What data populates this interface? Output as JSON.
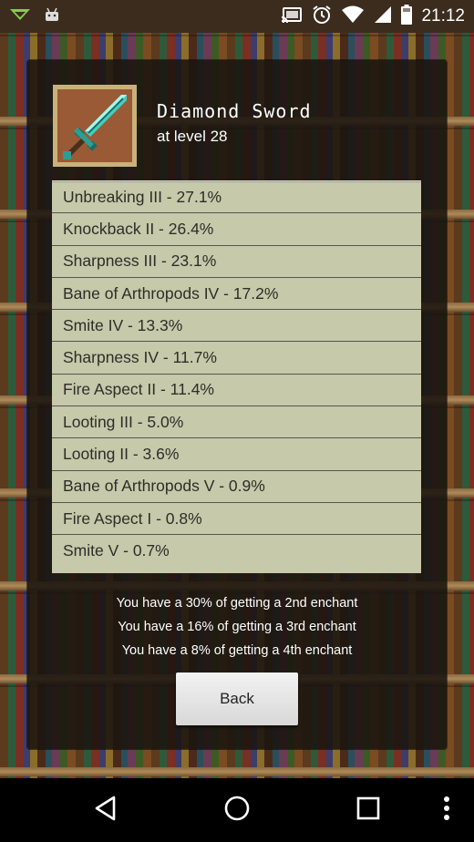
{
  "status_bar": {
    "time": "21:12",
    "icons": [
      "download-notification-icon",
      "android-notification-icon",
      "cast-icon",
      "alarm-icon",
      "wifi-icon",
      "signal-icon",
      "battery-icon"
    ]
  },
  "item": {
    "name": "Diamond Sword",
    "level_text": "at level 28",
    "icon": "diamond-sword-icon"
  },
  "enchants": [
    "Unbreaking III - 27.1%",
    "Knockback II - 26.4%",
    "Sharpness III - 23.1%",
    "Bane of Arthropods IV - 17.2%",
    "Smite IV - 13.3%",
    "Sharpness IV - 11.7%",
    "Fire Aspect II - 11.4%",
    "Looting III - 5.0%",
    "Looting II - 3.6%",
    "Bane of Arthropods V - 0.9%",
    "Fire Aspect I - 0.8%",
    "Smite V - 0.7%"
  ],
  "chances": [
    "You have a 30% of getting a 2nd enchant",
    "You have a 16% of getting a 3rd enchant",
    "You have a 8% of getting a 4th enchant"
  ],
  "back_label": "Back",
  "nav": [
    "back-nav-icon",
    "home-nav-icon",
    "recents-nav-icon",
    "overflow-menu-icon"
  ],
  "colors": {
    "list_bg": "#c6c9aa",
    "panel_bg": "#1a140f",
    "status_bg": "#3b2c1e"
  }
}
